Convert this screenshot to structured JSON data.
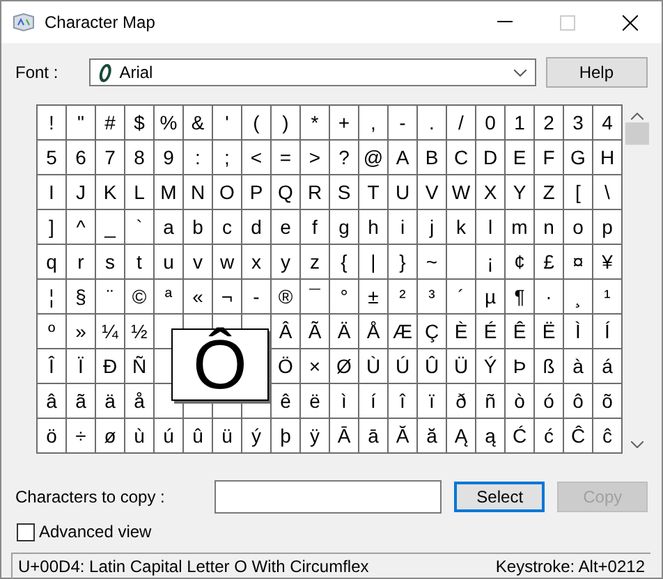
{
  "window": {
    "title": "Character Map",
    "controls": [
      {
        "kind": "minimize",
        "disabled": false
      },
      {
        "kind": "maximize",
        "disabled": true
      },
      {
        "kind": "close",
        "disabled": false
      }
    ]
  },
  "font": {
    "label": "Font :",
    "value": "Arial"
  },
  "help_button": {
    "label": "Help"
  },
  "grid": {
    "rows": [
      [
        "!",
        "\"",
        "#",
        "$",
        "%",
        "&",
        "'",
        "(",
        ")",
        "*",
        "+",
        ",",
        "-",
        ".",
        "/",
        "0",
        "1",
        "2",
        "3",
        "4"
      ],
      [
        "5",
        "6",
        "7",
        "8",
        "9",
        ":",
        ";",
        "<",
        "=",
        ">",
        "?",
        "@",
        "A",
        "B",
        "C",
        "D",
        "E",
        "F",
        "G",
        "H"
      ],
      [
        "I",
        "J",
        "K",
        "L",
        "M",
        "N",
        "O",
        "P",
        "Q",
        "R",
        "S",
        "T",
        "U",
        "V",
        "W",
        "X",
        "Y",
        "Z",
        "[",
        "\\"
      ],
      [
        "]",
        "^",
        "_",
        "`",
        "a",
        "b",
        "c",
        "d",
        "e",
        "f",
        "g",
        "h",
        "i",
        "j",
        "k",
        "l",
        "m",
        "n",
        "o",
        "p"
      ],
      [
        "q",
        "r",
        "s",
        "t",
        "u",
        "v",
        "w",
        "x",
        "y",
        "z",
        "{",
        "|",
        "}",
        "~",
        null,
        "¡",
        "¢",
        "£",
        "¤",
        "¥"
      ],
      [
        "¦",
        "§",
        "¨",
        "©",
        "ª",
        "«",
        "¬",
        "-",
        "®",
        "¯",
        "°",
        "±",
        "²",
        "³",
        "´",
        "µ",
        "¶",
        "·",
        "¸",
        "¹"
      ],
      [
        "º",
        "»",
        "¼",
        "½",
        null,
        null,
        null,
        null,
        "Â",
        "Ã",
        "Ä",
        "Å",
        "Æ",
        "Ç",
        "È",
        "É",
        "Ê",
        "Ë",
        "Ì",
        "Í"
      ],
      [
        "Î",
        "Ï",
        "Ð",
        "Ñ",
        null,
        null,
        null,
        null,
        "Ö",
        "×",
        "Ø",
        "Ù",
        "Ú",
        "Û",
        "Ü",
        "Ý",
        "Þ",
        "ß",
        "à",
        "á"
      ],
      [
        "â",
        "ã",
        "ä",
        "å",
        null,
        null,
        null,
        null,
        "ê",
        "ë",
        "ì",
        "í",
        "î",
        "ï",
        "ð",
        "ñ",
        "ò",
        "ó",
        "ô",
        "õ"
      ],
      [
        "ö",
        "÷",
        "ø",
        "ù",
        "ú",
        "û",
        "ü",
        "ý",
        "þ",
        "ÿ",
        "Ā",
        "ā",
        "Ă",
        "ă",
        "Ą",
        "ą",
        "Ć",
        "ć",
        "Ĉ",
        "ĉ"
      ]
    ],
    "magnified": {
      "char": "Ô"
    }
  },
  "copy": {
    "label": "Characters to copy :"
  },
  "buttons": [
    {
      "label": "Select",
      "default": true,
      "disabled": false
    },
    {
      "label": "Copy",
      "default": false,
      "disabled": true
    }
  ],
  "advanced_view": {
    "label": "Advanced view",
    "checked": false
  },
  "status_bar": {
    "left": "U+00D4: Latin Capital Letter O With Circumflex",
    "right": "Keystroke: Alt+0212"
  }
}
